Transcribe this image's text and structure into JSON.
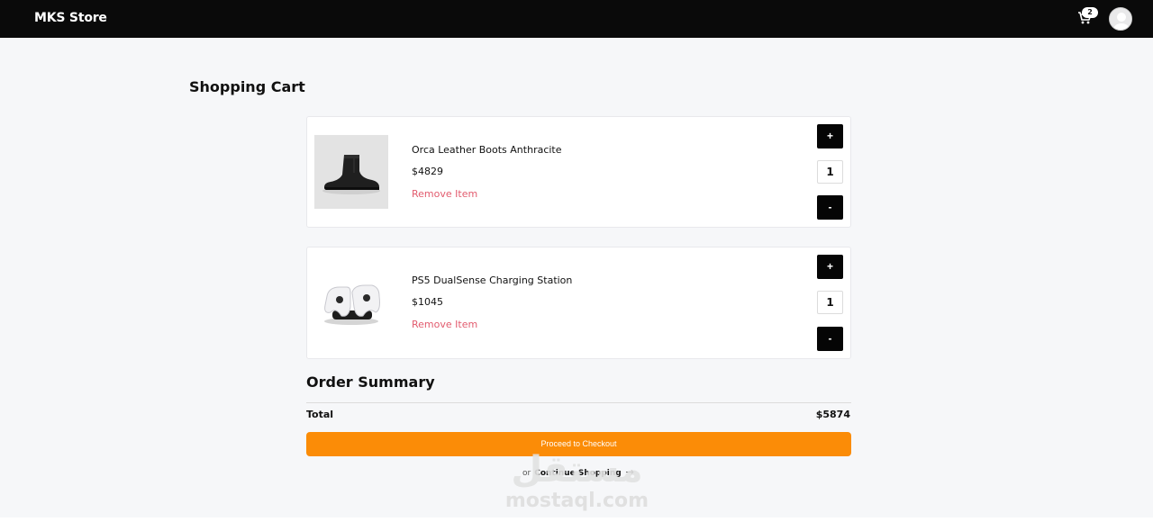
{
  "navbar": {
    "brand": "MKS Store",
    "cart_count": "2",
    "cart_icon": "cart-icon",
    "avatar_icon": "user-avatar-icon"
  },
  "page": {
    "title": "Shopping Cart"
  },
  "cart": {
    "items": [
      {
        "name": "Orca Leather Boots Anthracite",
        "price": "$4829",
        "remove_label": "Remove Item",
        "quantity": "1",
        "increment_label": "+",
        "decrement_label": "-",
        "image": "boot-image"
      },
      {
        "name": "PS5 DualSense Charging Station",
        "price": "$1045",
        "remove_label": "Remove Item",
        "quantity": "1",
        "increment_label": "+",
        "decrement_label": "-",
        "image": "controller-charger-image"
      }
    ]
  },
  "summary": {
    "title": "Order Summary",
    "total_label": "Total",
    "total_value": "$5874",
    "checkout_label": "Proceed to Checkout",
    "or_label": "or",
    "continue_label": "Continue Shopping",
    "continue_icon": "arrow-right-icon"
  },
  "watermark": {
    "arabic": "مستقل",
    "text": "mostaql.com"
  },
  "colors": {
    "navbar": "#0a0a0a",
    "background": "#f6f7f9",
    "accent": "#fb8c07",
    "remove": "#e25b6e"
  }
}
